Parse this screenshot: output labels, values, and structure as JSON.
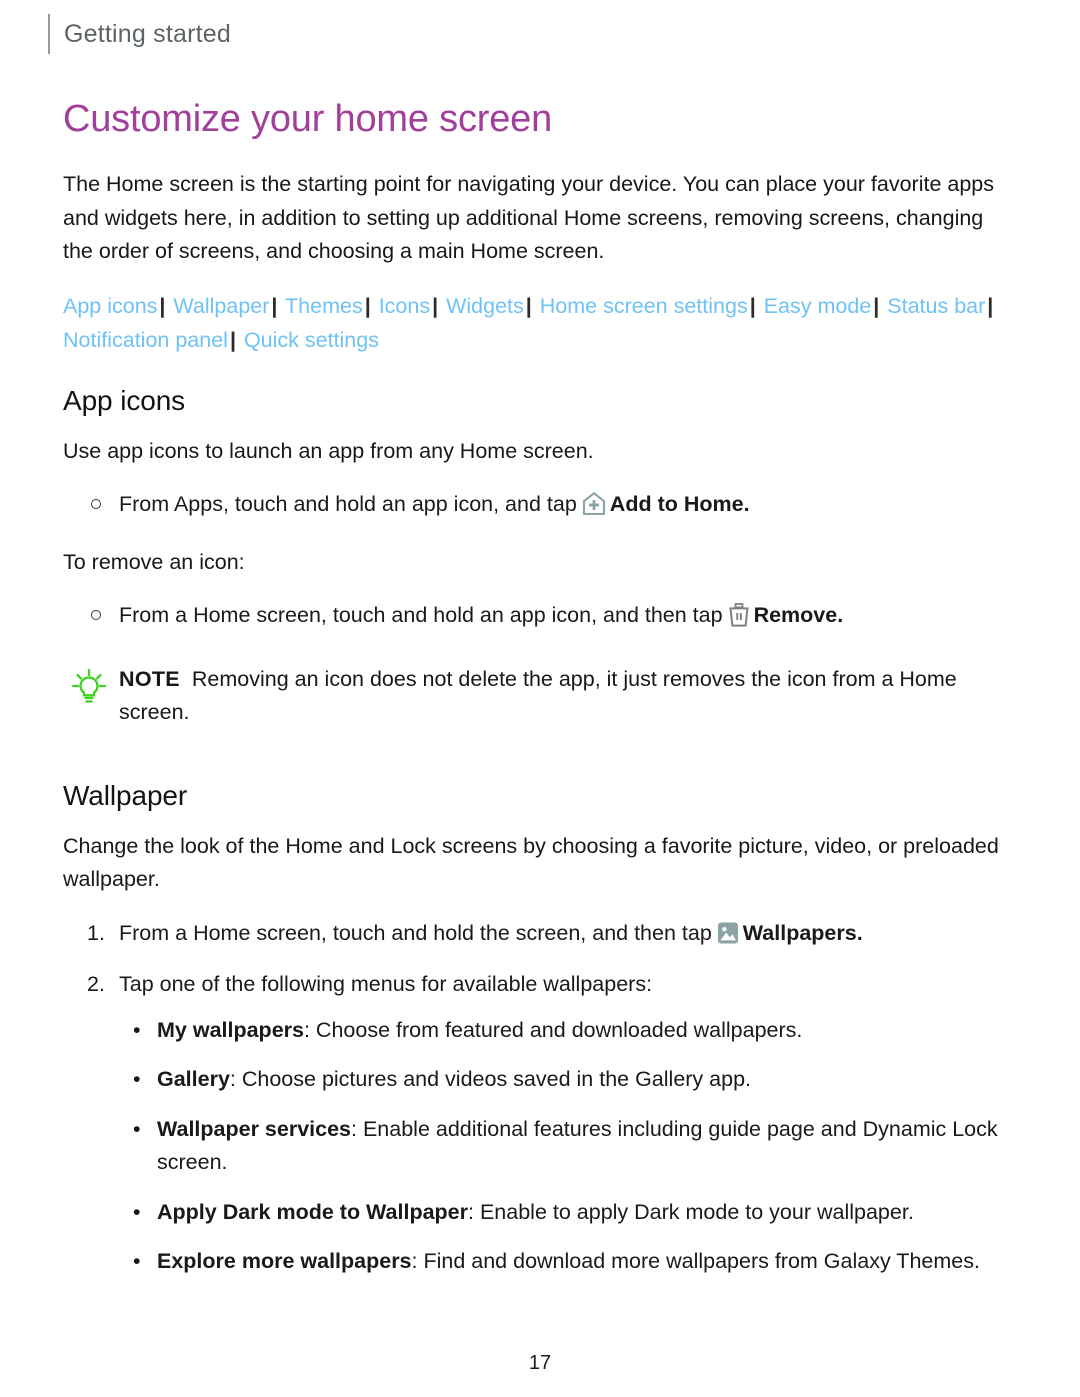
{
  "header": {
    "running_title": "Getting started"
  },
  "page_title": "Customize your home screen",
  "intro_paragraph": "The Home screen is the starting point for navigating your device. You can place your favorite apps and widgets here, in addition to setting up additional Home screens, removing screens, changing the order of screens, and choosing a main Home screen.",
  "nav_links": [
    "App icons",
    "Wallpaper",
    "Themes",
    "Icons",
    "Widgets",
    "Home screen settings",
    "Easy mode",
    "Status bar",
    "Notification panel",
    "Quick settings"
  ],
  "nav_separator": "|",
  "sections": [
    {
      "heading": "App icons",
      "intro": "Use app icons to launch an app from any Home screen.",
      "step_1_before": "From Apps, touch and hold an app icon, and tap",
      "step_1_icon": "add-to-home-icon",
      "step_1_bold": "Add to Home.",
      "remove_intro": "To remove an icon:",
      "step_2_before": "From a Home screen, touch and hold an app icon, and then tap",
      "step_2_icon": "trash-icon",
      "step_2_bold": "Remove.",
      "note_label": "NOTE",
      "note_text": "Removing an icon does not delete the app, it just removes the icon from a Home screen."
    },
    {
      "heading": "Wallpaper",
      "intro": "Change the look of the Home and Lock screens by choosing a favorite picture, video, or preloaded wallpaper.",
      "steps": [
        {
          "number": "1.",
          "before": "From a Home screen, touch and hold the screen, and then tap",
          "icon": "wallpapers-image-icon",
          "bold": "Wallpapers."
        },
        {
          "number": "2.",
          "before": "Tap one of the following menus for available wallpapers:",
          "icon": "",
          "bold": ""
        }
      ],
      "menu_bullets": [
        {
          "marker": "•",
          "lead": "My wallpapers",
          "rest": ": Choose from featured and downloaded wallpapers."
        },
        {
          "marker": "•",
          "lead": "Gallery",
          "rest": ": Choose pictures and videos saved in the Gallery app."
        },
        {
          "marker": "•",
          "lead": "Wallpaper services",
          "rest": ": Enable additional features including guide page and Dynamic Lock screen."
        },
        {
          "marker": "•",
          "lead": "Apply Dark mode to Wallpaper",
          "rest": ": Enable to apply Dark mode to your wallpaper."
        },
        {
          "marker": "•",
          "lead": "Explore more wallpapers",
          "rest": ": Find and download more wallpapers from Galaxy Themes."
        }
      ]
    }
  ],
  "page_number": "17",
  "colors": {
    "title_purple": "#a23f9b",
    "link_blue": "#6fc2f5",
    "icon_slate": "#8ba3a5",
    "trash_gray": "#808080",
    "bulb_green": "#3fd321",
    "header_gray": "#5d6468"
  }
}
